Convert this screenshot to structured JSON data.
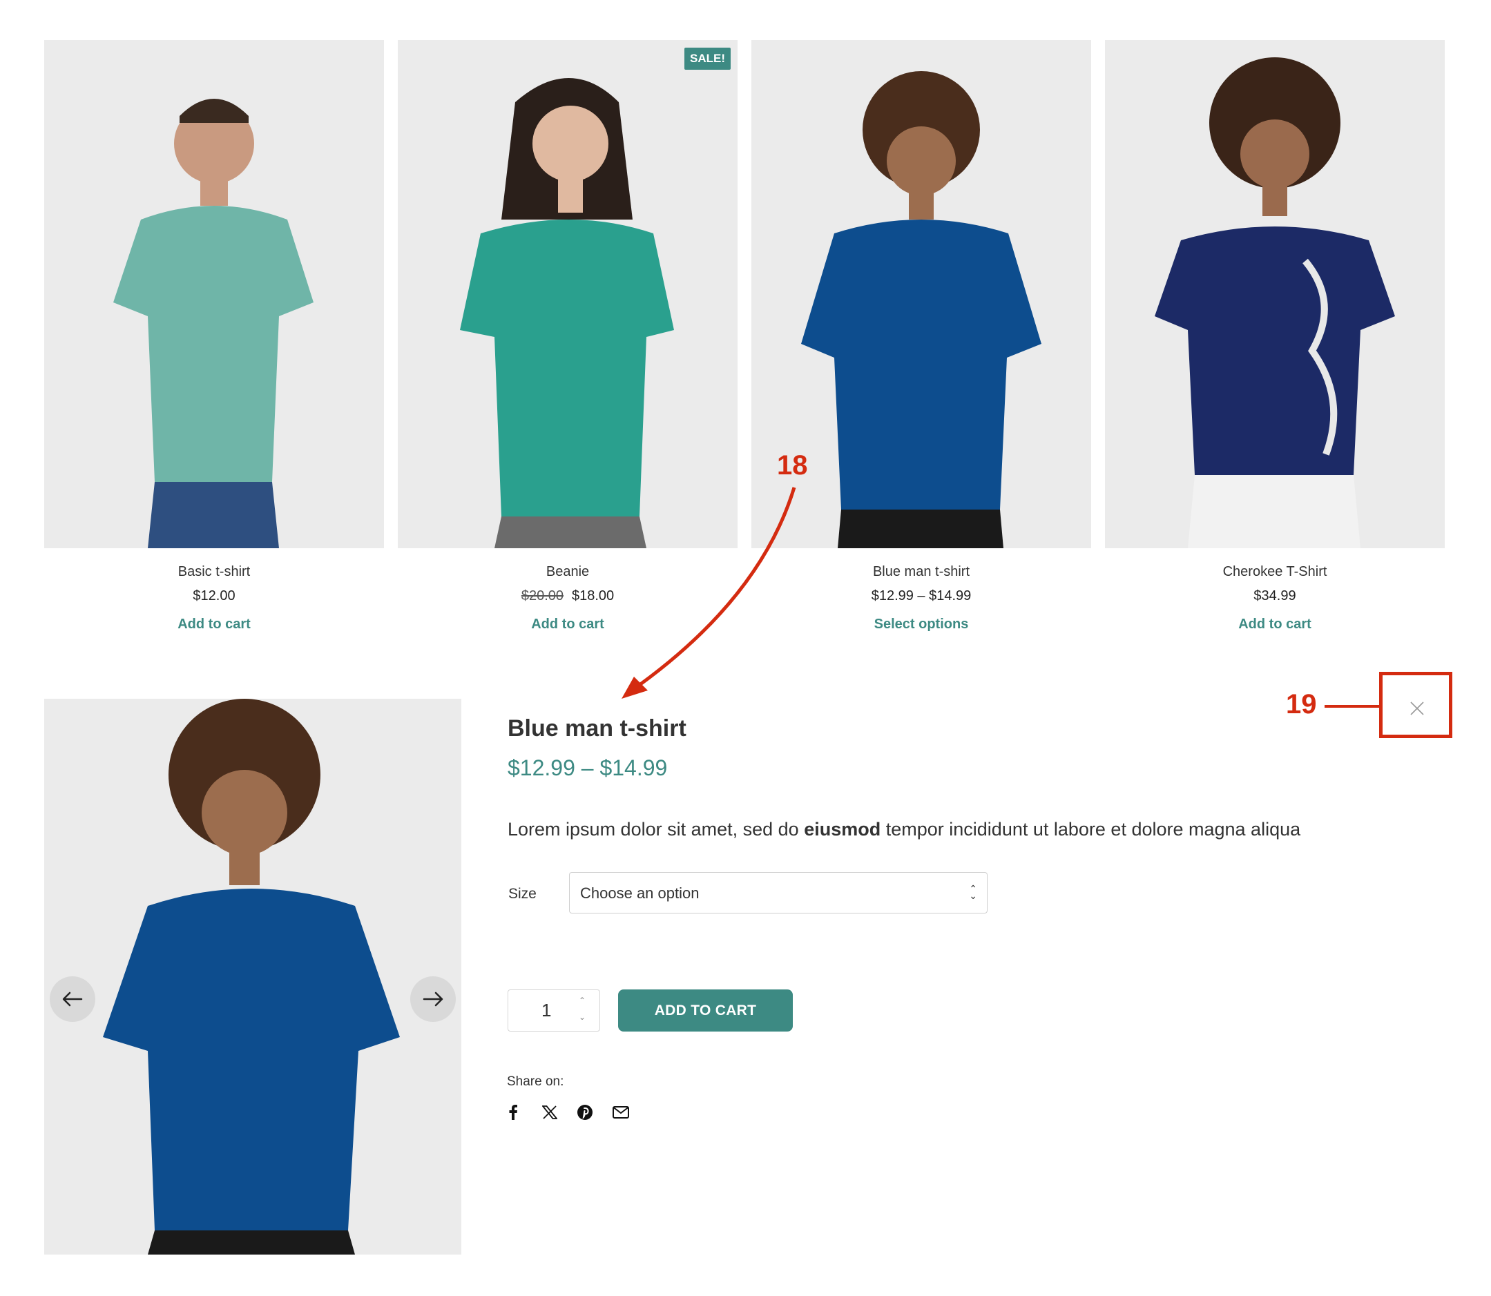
{
  "products": [
    {
      "name": "Basic t-shirt",
      "old_price": "",
      "price": "$12.00",
      "cta": "Add to cart",
      "badge": ""
    },
    {
      "name": "Beanie",
      "old_price": "$20.00",
      "price": "$18.00",
      "cta": "Add to cart",
      "badge": "SALE!"
    },
    {
      "name": "Blue man t-shirt",
      "old_price": "",
      "price": "$12.99 – $14.99",
      "cta": "Select options",
      "badge": ""
    },
    {
      "name": "Cherokee T-Shirt",
      "old_price": "",
      "price": "$34.99",
      "cta": "Add to cart",
      "badge": ""
    }
  ],
  "quick_view": {
    "title": "Blue man t-shirt",
    "price_range": "$12.99 – $14.99",
    "description_before": "Lorem ipsum dolor sit amet, sed do ",
    "description_bold": "eiusmod",
    "description_after": " tempor incididunt ut labore et dolore magna aliqua",
    "size_label": "Size",
    "size_select_value": "Choose an option",
    "quantity": "1",
    "add_to_cart": "ADD TO CART",
    "share_label": "Share on:",
    "share_icons": [
      "facebook-icon",
      "x-icon",
      "pinterest-icon",
      "email-icon"
    ]
  },
  "annotations": {
    "arrow_label": "18",
    "close_label": "19"
  },
  "colors": {
    "accent": "#3d8a83",
    "annotation": "#d42b10",
    "image_bg": "#ebebeb"
  }
}
